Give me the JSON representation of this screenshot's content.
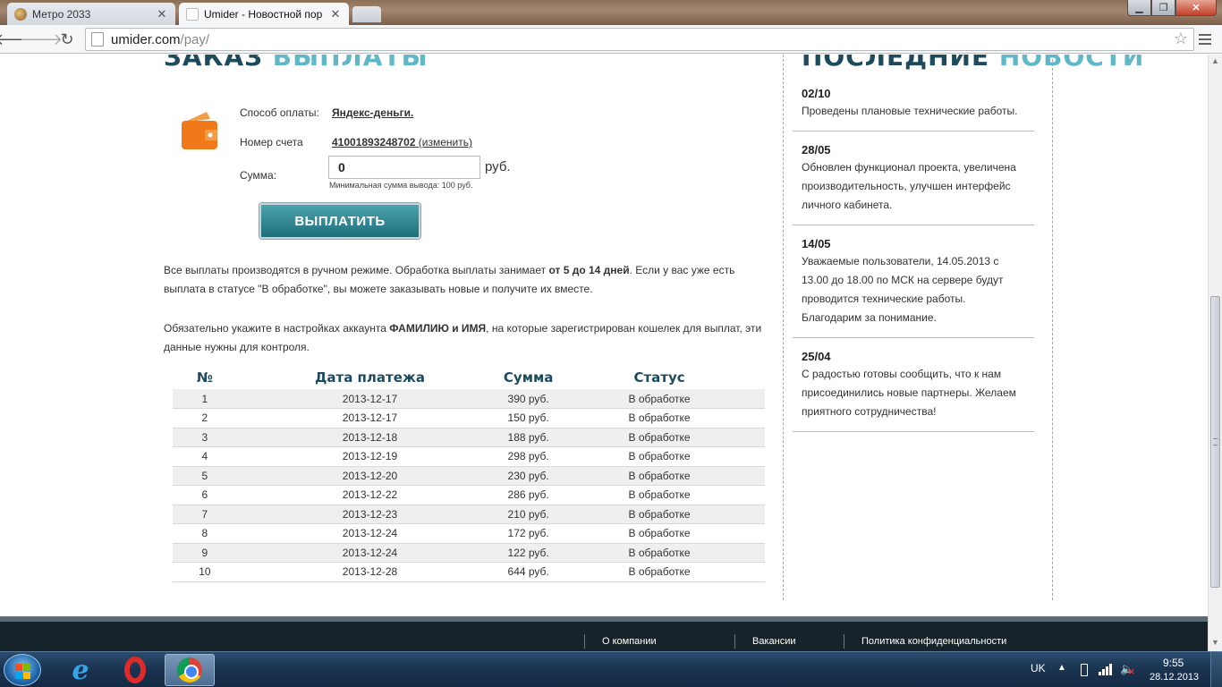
{
  "browser": {
    "tabs": [
      {
        "title": "Метро 2033"
      },
      {
        "title": "Umider - Новостной пор"
      }
    ],
    "url_domain": "umider.com",
    "url_path": "/pay/"
  },
  "page": {
    "heading_part1": "ЗАКАЗ",
    "heading_part2": "ВЫПЛАТЫ",
    "form": {
      "method_label": "Способ оплаты:",
      "method_value": "Яндекс-деньги.",
      "account_label": "Номер счета",
      "account_value": "41001893248702",
      "account_change": "(изменить)",
      "amount_label": "Сумма:",
      "amount_value": "0",
      "amount_currency": "руб.",
      "amount_hint": "Минимальная сумма вывода: 100 руб.",
      "submit_label": "ВЫПЛАТИТЬ"
    },
    "info1": {
      "text_a": "Все выплаты производятся в ручном режиме. Обработка выплаты занимает ",
      "bold": "от 5 до 14 дней",
      "text_b": ". Если у вас уже есть выплата в статусе \"В обработке\", вы можете заказывать новые и получите их вместе."
    },
    "info2": {
      "text_a": "Обязательно укажите в настройках аккаунта ",
      "bold": "ФАМИЛИЮ и ИМЯ",
      "text_b": ", на которые зарегистрирован кошелек для выплат, эти данные нужны для контроля."
    },
    "table": {
      "headers": [
        "№",
        "Дата платежа",
        "Сумма",
        "Статус"
      ],
      "rows": [
        [
          "1",
          "2013-12-17",
          "390 руб.",
          "В обработке"
        ],
        [
          "2",
          "2013-12-17",
          "150 руб.",
          "В обработке"
        ],
        [
          "3",
          "2013-12-18",
          "188 руб.",
          "В обработке"
        ],
        [
          "4",
          "2013-12-19",
          "298 руб.",
          "В обработке"
        ],
        [
          "5",
          "2013-12-20",
          "230 руб.",
          "В обработке"
        ],
        [
          "6",
          "2013-12-22",
          "286 руб.",
          "В обработке"
        ],
        [
          "7",
          "2013-12-23",
          "210 руб.",
          "В обработке"
        ],
        [
          "8",
          "2013-12-24",
          "172 руб.",
          "В обработке"
        ],
        [
          "9",
          "2013-12-24",
          "122 руб.",
          "В обработке"
        ],
        [
          "10",
          "2013-12-28",
          "644 руб.",
          "В обработке"
        ]
      ]
    }
  },
  "sidebar": {
    "heading_part1": "ПОСЛЕДНИЕ",
    "heading_part2": "НОВОСТИ",
    "news": [
      {
        "date": "02/10",
        "text": "Проведены плановые технические работы."
      },
      {
        "date": "28/05",
        "text": "Обновлен функционал проекта, увеличена производительность, улучшен интерфейс личного кабинета."
      },
      {
        "date": "14/05",
        "text": "Уважаемые пользователи, 14.05.2013 с 13.00 до 18.00 по МСК на сервере будут проводится технические работы. Благодарим за понимание."
      },
      {
        "date": "25/04",
        "text": "С радостью готовы сообщить, что к нам присоединились новые партнеры. Желаем приятного сотрудничества!"
      }
    ]
  },
  "footer": {
    "links": [
      "О компании",
      "Вакансии",
      "Политика конфиденциальности"
    ]
  },
  "taskbar": {
    "language": "UK",
    "time": "9:55",
    "date": "28.12.2013"
  },
  "colors": {
    "accent_dark": "#1e4a5e",
    "accent_light": "#5fb7c7",
    "button": "#2b8592",
    "wallet": "#f07a1a",
    "footer_bg": "#16232b"
  }
}
